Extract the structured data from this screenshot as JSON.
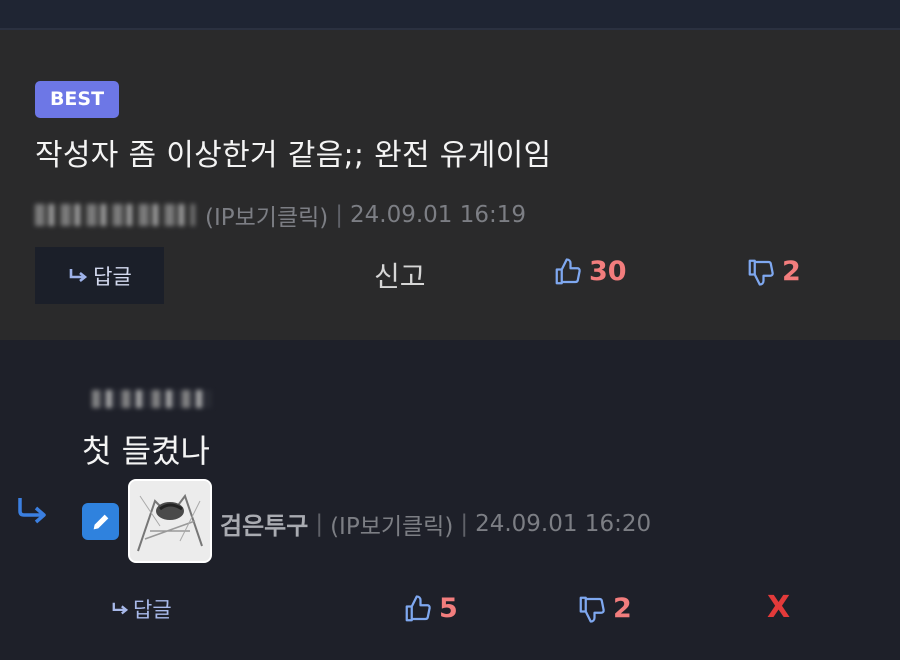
{
  "best_post": {
    "badge": "BEST",
    "title": "작성자 좀 이상한거 같음;; 완전 유게이임",
    "ip_label": "(IP보기클릭)",
    "separator": "|",
    "timestamp": "24.09.01 16:19",
    "reply_label": "답글",
    "report_label": "신고",
    "upvotes": "30",
    "downvotes": "2"
  },
  "comment": {
    "text": "첫 들켰나",
    "author": "검은투구",
    "ip_label": "(IP보기클릭)",
    "separator": "|",
    "timestamp": "24.09.01 16:20",
    "reply_label": "답글",
    "upvotes": "5",
    "downvotes": "2",
    "delete_label": "X"
  },
  "colors": {
    "badge": "#6d77e6",
    "vote_count": "#f27d7d",
    "thumb_icon": "#7fa8f0",
    "edit_icon_bg": "#2f82de",
    "delete": "#e33a3a"
  }
}
